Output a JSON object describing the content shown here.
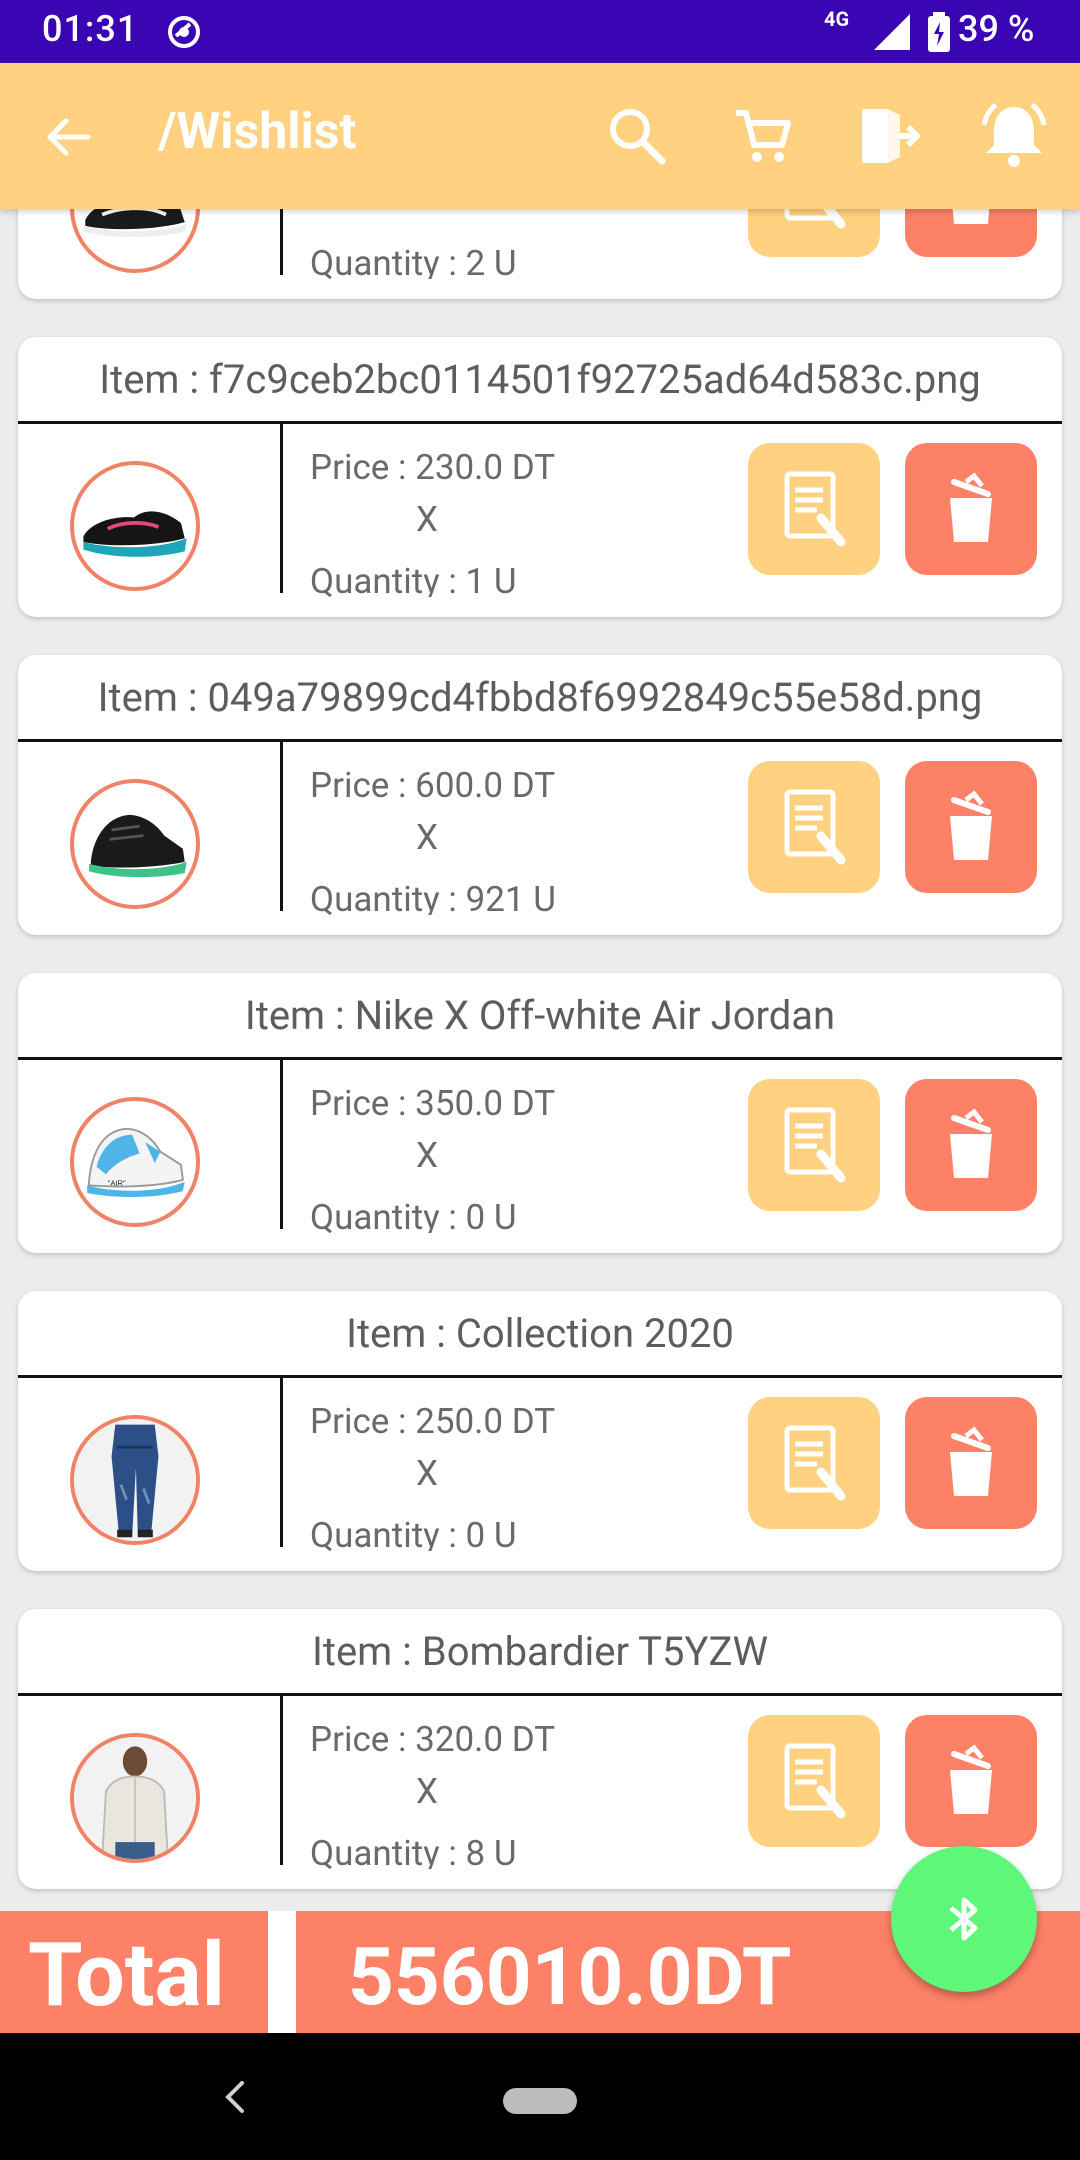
{
  "status_bar": {
    "time": "01:31",
    "network": "4G",
    "battery": "39 %"
  },
  "app_bar": {
    "title": "/Wishlist"
  },
  "items": [
    {
      "title": "",
      "price": "",
      "x": "",
      "quantity": "Quantity : 2 U",
      "image": "shoe-black-white-icon"
    },
    {
      "title": "Item : f7c9ceb2bc0114501f92725ad64d583c.png",
      "price": "Price : 230.0 DT",
      "x": "X",
      "quantity": "Quantity : 1 U",
      "image": "shoe-black-teal-icon"
    },
    {
      "title": "Item : 049a79899cd4fbbd8f6992849c55e58d.png",
      "price": "Price : 600.0 DT",
      "x": "X",
      "quantity": "Quantity : 921 U",
      "image": "boot-black-green-icon"
    },
    {
      "title": "Item : Nike X Off-white Air Jordan",
      "price": "Price : 350.0 DT",
      "x": "X",
      "quantity": "Quantity : 0 U",
      "image": "shoe-blue-white-icon"
    },
    {
      "title": "Item : Collection 2020",
      "price": "Price : 250.0 DT",
      "x": "X",
      "quantity": "Quantity : 0 U",
      "image": "jeans-icon"
    },
    {
      "title": "Item : Bombardier T5YZW",
      "price": "Price : 320.0 DT",
      "x": "X",
      "quantity": "Quantity : 8 U",
      "image": "person-jacket-icon"
    }
  ],
  "total": {
    "label": "Total",
    "value": "556010.0DT"
  },
  "colors": {
    "accent": "#ffd180",
    "delete": "#fc8166",
    "status_bar": "#3a06b3",
    "fab": "#5ef77a"
  }
}
